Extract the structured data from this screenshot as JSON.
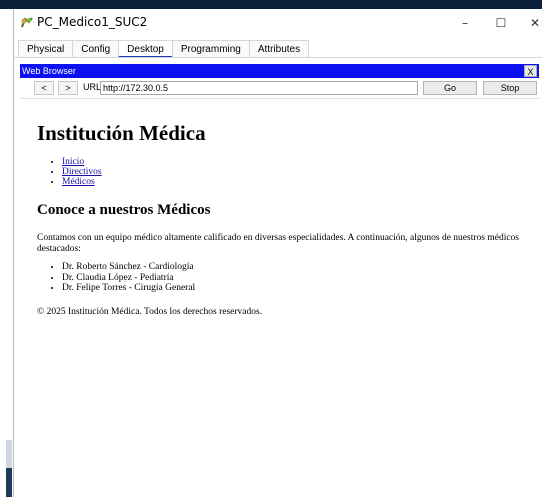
{
  "window": {
    "title": "PC_Medico1_SUC2",
    "controls": {
      "minimize": "–",
      "maximize": "☐",
      "close": "✕"
    }
  },
  "tabs": [
    "Physical",
    "Config",
    "Desktop",
    "Programming",
    "Attributes"
  ],
  "active_tab": "Desktop",
  "browser": {
    "title": "Web Browser",
    "close_label": "X",
    "back_label": "<",
    "forward_label": ">",
    "url_label": "URL",
    "url_value": "http://172.30.0.5",
    "go_label": "Go",
    "stop_label": "Stop"
  },
  "page": {
    "heading": "Institución Médica",
    "nav_links": [
      "Inicio",
      "Directivos",
      "Médicos"
    ],
    "section_title": "Conoce a nuestros Médicos",
    "intro": "Contamos con un equipo médico altamente calificado en diversas especialidades. A continuación, algunos de nuestros médicos destacados:",
    "doctors": [
      "Dr. Roberto Sánchez - Cardiología",
      "Dr. Claudia López - Pediatría",
      "Dr. Felipe Torres - Cirugía General"
    ],
    "footer": "© 2025 Institución Médica. Todos los derechos reservados."
  },
  "colors": {
    "browser_bar": "#0a10f0",
    "link": "#1a0dab",
    "tab_underline": "#1f3ec4"
  },
  "icons": {
    "app": "packet-tracer-pc-icon"
  }
}
